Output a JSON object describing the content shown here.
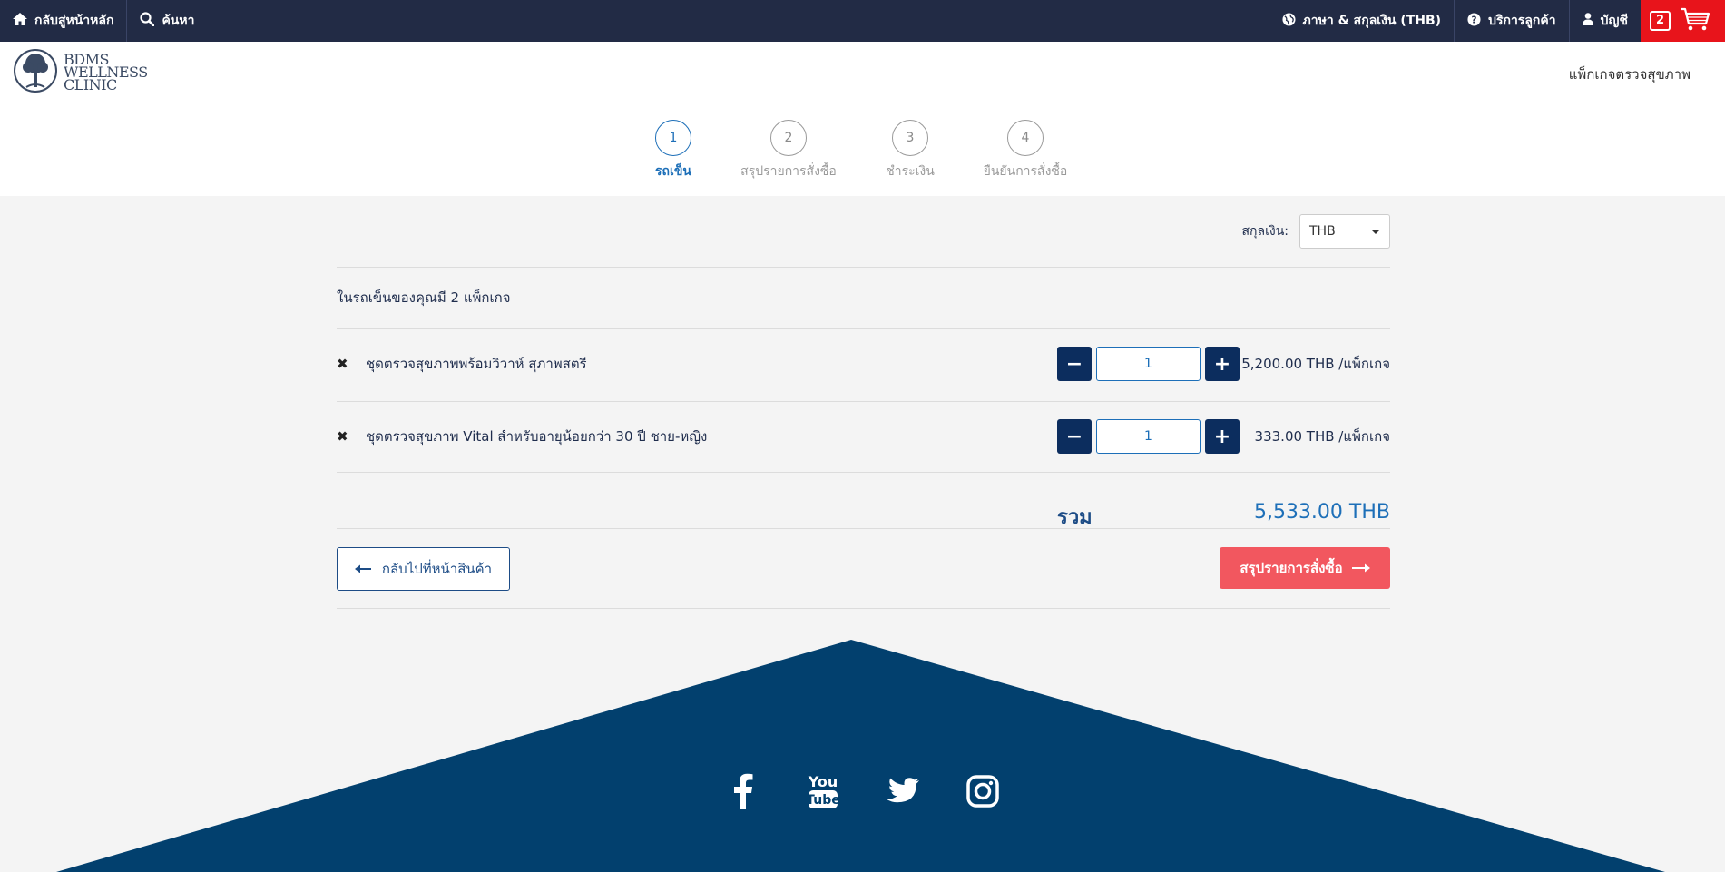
{
  "topbar": {
    "home_label": "กลับสู่หน้าหลัก",
    "search_label": "ค้นหา",
    "language_label": "ภาษา & สกุลเงิน (THB)",
    "support_label": "บริการลูกค้า",
    "account_label": "บัญชี",
    "cart_count": "2"
  },
  "header": {
    "logo_line1": "BDMS",
    "logo_line2": "WELLNESS",
    "logo_line3": "CLINIC",
    "nav_link": "แพ็กเกจตรวจสุขภาพ"
  },
  "steps": [
    {
      "number": "1",
      "label": "รถเข็น",
      "active": true
    },
    {
      "number": "2",
      "label": "สรุปรายการสั่งซื้อ",
      "active": false
    },
    {
      "number": "3",
      "label": "ชำระเงิน",
      "active": false
    },
    {
      "number": "4",
      "label": "ยืนยันการสั่งซื้อ",
      "active": false
    }
  ],
  "cart": {
    "currency_label": "สกุลเงิน:",
    "currency_value": "THB",
    "count_text": "ในรถเข็นของคุณมี 2 แพ็กเกจ",
    "items": [
      {
        "name": "ชุดตรวจสุขภาพพร้อมวิวาห์ สุภาพสตรี",
        "quantity": "1",
        "price": "5,200.00 THB /แพ็กเกจ"
      },
      {
        "name": "ชุดตรวจสุขภาพ Vital สำหรับอายุน้อยกว่า 30 ปี ชาย-หญิง",
        "quantity": "1",
        "price": "333.00 THB /แพ็กเกจ"
      }
    ],
    "total_label": "รวม",
    "total_value": "5,533.00 THB",
    "back_button": "กลับไปที่หน้าสินค้า",
    "next_button": "สรุปรายการสั่งซื้อ"
  },
  "colors": {
    "topbar": "#222b45",
    "primary": "#0c2d5e",
    "accent": "#1d6fb8",
    "cta": "#f2575f",
    "cart_red": "#e8141b",
    "footer": "#02406e"
  },
  "footer": {
    "socials": [
      "facebook-icon",
      "youtube-icon",
      "twitter-icon",
      "instagram-icon"
    ]
  }
}
